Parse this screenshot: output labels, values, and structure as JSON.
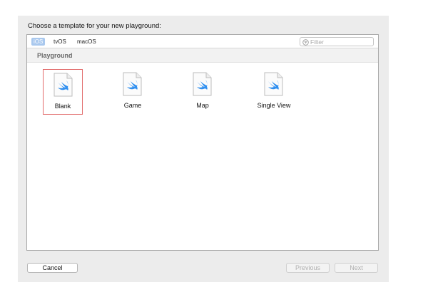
{
  "dialog": {
    "prompt": "Choose a template for your new playground:"
  },
  "platform_tabs": [
    {
      "label": "iOS",
      "selected": true
    },
    {
      "label": "tvOS",
      "selected": false
    },
    {
      "label": "macOS",
      "selected": false
    }
  ],
  "filter": {
    "placeholder": "Filter",
    "value": ""
  },
  "section": {
    "title": "Playground"
  },
  "templates": [
    {
      "label": "Blank",
      "icon": "swift-file-icon",
      "selected": true
    },
    {
      "label": "Game",
      "icon": "swift-file-icon",
      "selected": false
    },
    {
      "label": "Map",
      "icon": "swift-file-icon",
      "selected": false
    },
    {
      "label": "Single View",
      "icon": "swift-file-icon",
      "selected": false
    }
  ],
  "buttons": {
    "cancel": "Cancel",
    "previous": "Previous",
    "next": "Next"
  },
  "colors": {
    "selected_tab": "#a9c8ee",
    "selection_border": "#e26b6b",
    "swift_blue": "#2f8ff0"
  }
}
